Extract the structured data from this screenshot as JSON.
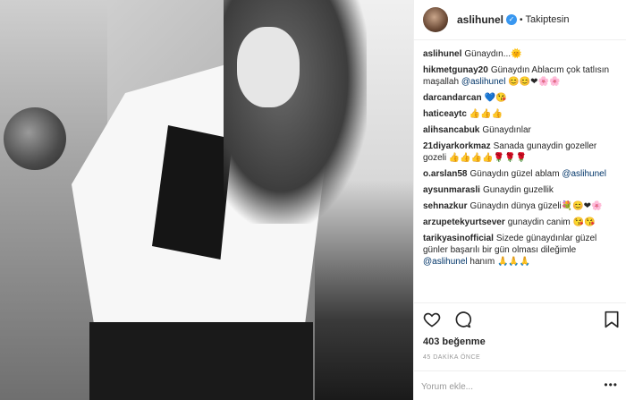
{
  "header": {
    "username": "aslihunel",
    "verified_glyph": "✓",
    "separator": "•",
    "follow_status": "Takiptesin"
  },
  "comments": [
    {
      "user": "aslihunel",
      "text": "Günaydın...🌞"
    },
    {
      "user": "hikmetgunay20",
      "text": "Günaydın Ablacım çok tatlısın maşallah",
      "mention": "@aslihunel",
      "after": " 😊😊❤🌸🌸"
    },
    {
      "user": "darcandarcan",
      "text": "💙😘"
    },
    {
      "user": "haticeaytc",
      "text": "👍👍👍"
    },
    {
      "user": "alihsancabuk",
      "text": "Günaydınlar"
    },
    {
      "user": "21diyarkorkmaz",
      "text": "Sanada gunaydin gozeller gozeli 👍👍👍👍🌹🌹🌹"
    },
    {
      "user": "o.arslan58",
      "text": "Günaydın güzel ablam",
      "mention": "@aslihunel",
      "after": ""
    },
    {
      "user": "aysunmarasli",
      "text": "Gunaydin guzellik"
    },
    {
      "user": "sehnazkur",
      "text": "Günaydın dünya güzeli💐😊❤🌸"
    },
    {
      "user": "arzupetekyurtsever",
      "text": "gunaydin canim 😘😘"
    },
    {
      "user": "tarikyasinofficial",
      "text": "Sizede günaydınlar güzel günler başarılı bir gün olması dileğimle",
      "mention": "@aslihunel",
      "after": " hanım 🙏🙏🙏"
    }
  ],
  "actions": {
    "like_icon": "heart-icon",
    "comment_icon": "comment-icon",
    "save_icon": "bookmark-icon"
  },
  "likes_text": "403 beğenme",
  "timestamp": "45 DAKİKA ÖNCE",
  "add_comment": {
    "placeholder": "Yorum ekle...",
    "more": "•••"
  }
}
